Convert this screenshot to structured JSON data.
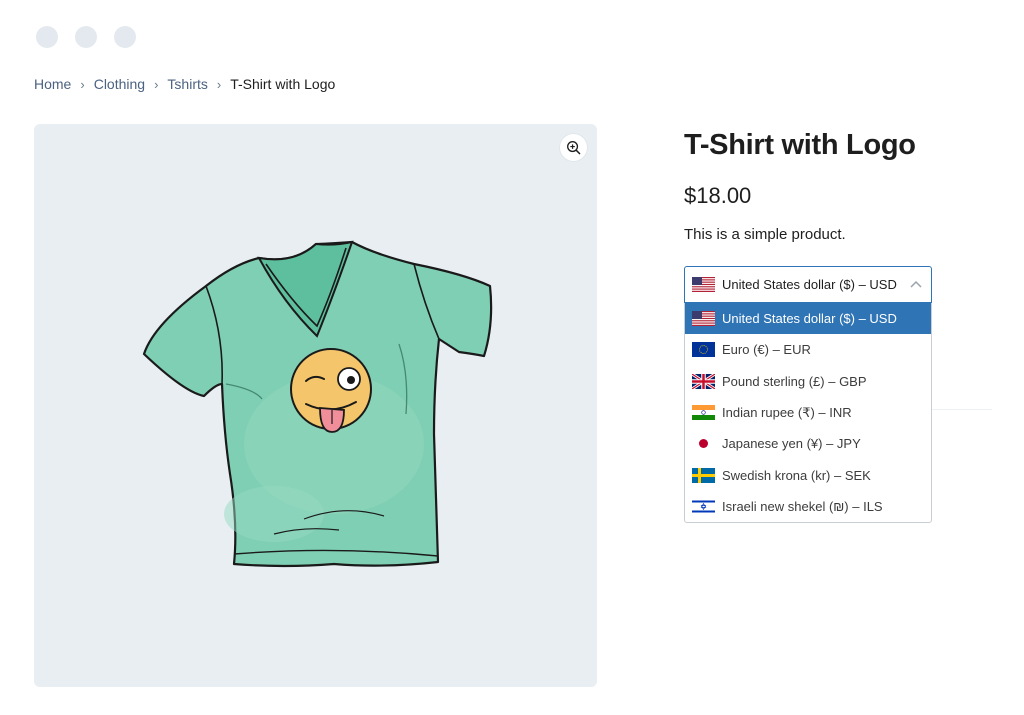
{
  "breadcrumb": {
    "items": [
      "Home",
      "Clothing",
      "Tshirts"
    ],
    "current": "T-Shirt with Logo",
    "separator": "›"
  },
  "product": {
    "title": "T-Shirt with Logo",
    "price": "$18.00",
    "short_description": "This is a simple product."
  },
  "gallery": {
    "zoom_icon": "zoom-in-icon",
    "image": "t-shirt-with-logo"
  },
  "currency_switcher": {
    "selected": "United States dollar ($) – USD",
    "options": [
      {
        "label": "United States dollar ($) – USD",
        "flag": "us-flag-icon"
      },
      {
        "label": "Euro (€) – EUR",
        "flag": "eu-flag-icon"
      },
      {
        "label": "Pound sterling (£) – GBP",
        "flag": "uk-flag-icon"
      },
      {
        "label": "Indian rupee (₹) – INR",
        "flag": "india-flag-icon"
      },
      {
        "label": "Japanese yen (¥) – JPY",
        "flag": "japan-flag-icon"
      },
      {
        "label": "Swedish krona (kr) – SEK",
        "flag": "sweden-flag-icon"
      },
      {
        "label": "Israeli new shekel (₪) – ILS",
        "flag": "israel-flag-icon"
      }
    ]
  },
  "colors": {
    "accent": "#2f74b5",
    "gallery_bg": "#e8eef2",
    "link": "#4b6281"
  }
}
